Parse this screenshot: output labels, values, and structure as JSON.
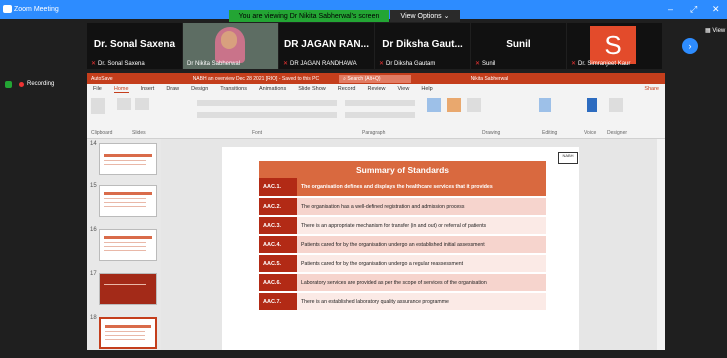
{
  "zoom": {
    "app_title": "Zoom Meeting",
    "share_banner": "You are viewing Dr Nikita Sabherwal's screen",
    "view_options": "View Options",
    "view_label": "View",
    "recording": "Recording"
  },
  "participants": [
    {
      "big": "Dr. Sonal Saxena",
      "small": "Dr. Sonal Saxena"
    },
    {
      "big": "",
      "small": "Dr Nikita Sabherwal"
    },
    {
      "big": "DR JAGAN RAN...",
      "small": "DR JAGAN RANDHAWA"
    },
    {
      "big": "Dr Diksha Gaut...",
      "small": "Dr Diksha Gautam"
    },
    {
      "big": "Sunil",
      "small": "Sunil"
    },
    {
      "big": "S",
      "small": "Dr. Simranjeet Kaur"
    }
  ],
  "ppt": {
    "autosave": "AutoSave",
    "file": "NABH an overview Dec 28 2021 [RIO] - Saved to this PC",
    "search": "Search (Alt+Q)",
    "user": "Nikita Sabherwal",
    "tabs": [
      "File",
      "Home",
      "Insert",
      "Draw",
      "Design",
      "Transitions",
      "Animations",
      "Slide Show",
      "Record",
      "Review",
      "View",
      "Help"
    ],
    "share": "Share",
    "groups": [
      "Clipboard",
      "Slides",
      "Font",
      "Paragraph",
      "Drawing",
      "Editing",
      "Voice",
      "Designer"
    ],
    "ribbon_labels": [
      "Paste",
      "New Slide",
      "Reuse Slides",
      "Layout",
      "Reset",
      "Section",
      "Shapes",
      "Arrange",
      "Quick Styles",
      "Shape Fill",
      "Shape Outline",
      "Shape Effects",
      "Find",
      "Replace",
      "Select",
      "Dictate",
      "Design Ideas"
    ]
  },
  "thumbnails": [
    "14",
    "15",
    "16",
    "17",
    "18"
  ],
  "slide": {
    "title": "Summary of Standards",
    "logo": "NABH",
    "rows": [
      {
        "code": "AAC.1.",
        "text": "The organisation defines and displays the healthcare services that it provides"
      },
      {
        "code": "AAC.2.",
        "text": "The organisation has a well-defined registration and admission process"
      },
      {
        "code": "AAC.3.",
        "text": "There is an appropriate mechanism for transfer (in and out) or referral of patients"
      },
      {
        "code": "AAC.4.",
        "text": "Patients cared for by the organisation undergo an established initial assessment"
      },
      {
        "code": "AAC.5.",
        "text": "Patients cared for by the organisation undergo a regular reassessment"
      },
      {
        "code": "AAC.6.",
        "text": "Laboratory services are provided as per the scope of services of the organisation"
      },
      {
        "code": "AAC.7.",
        "text": "There is an established laboratory quality assurance programme"
      }
    ]
  }
}
